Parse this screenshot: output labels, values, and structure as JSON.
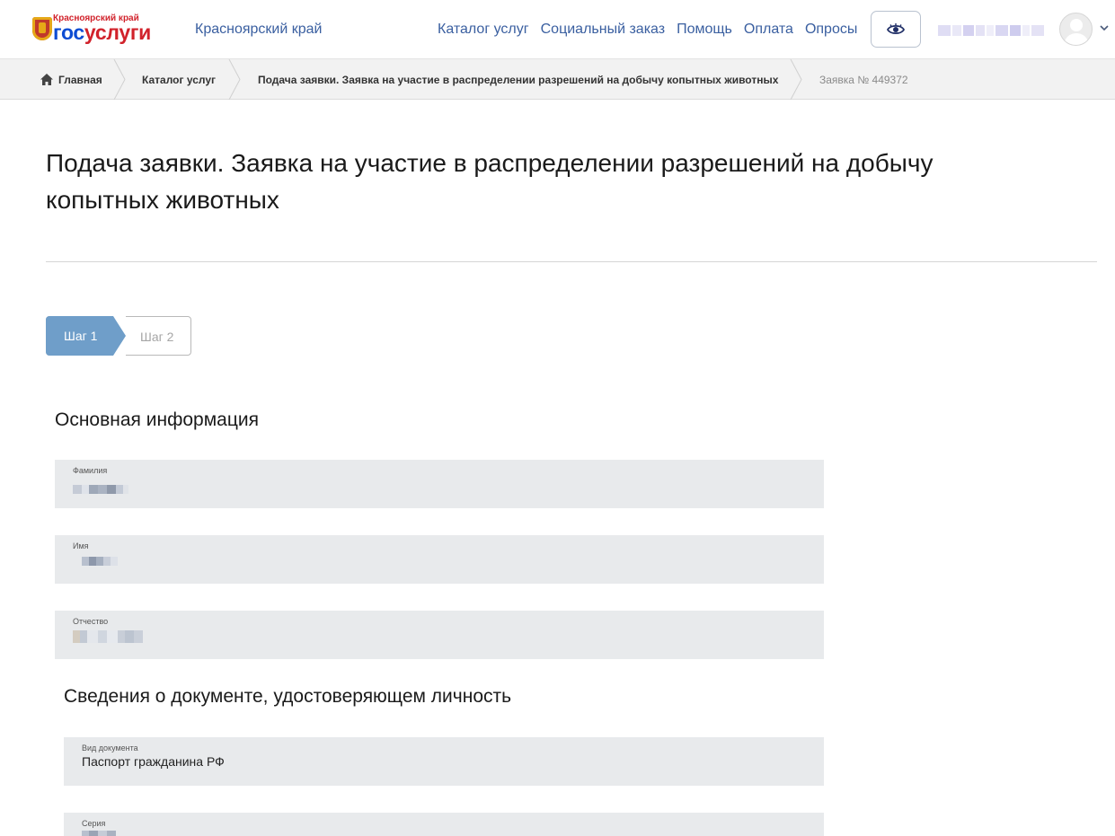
{
  "header": {
    "logo_region": "Красноярский край",
    "logo_part1": "гос",
    "logo_part2": "услуги",
    "region_label": "Красноярский край",
    "nav": [
      "Каталог услуг",
      "Социальный заказ",
      "Помощь",
      "Оплата",
      "Опросы"
    ],
    "accessibility_icon": "eye-icon",
    "user_icon": "avatar-icon",
    "menu_icon": "chevron-down-icon"
  },
  "breadcrumb": {
    "home_icon": "home-icon",
    "items": [
      "Главная",
      "Каталог услуг",
      "Подача заявки. Заявка на участие в распределении разрешений на добычу копытных животных",
      "Заявка № 449372"
    ]
  },
  "page": {
    "title": "Подача заявки. Заявка на участие в распределении разрешений на добычу копытных животных"
  },
  "steps": {
    "step1": "Шаг 1",
    "step2": "Шаг 2"
  },
  "sections": {
    "basic": {
      "title": "Основная информация",
      "fields": [
        {
          "label": "Фамилия"
        },
        {
          "label": "Имя"
        },
        {
          "label": "Отчество"
        }
      ]
    },
    "document": {
      "title": "Сведения о документе, удостоверяющем личность",
      "fields": [
        {
          "label": "Вид документа",
          "value": "Паспорт гражданина РФ"
        },
        {
          "label": "Серия"
        }
      ]
    }
  },
  "colors": {
    "link": "#3a5fa0",
    "active_step": "#6f9ec9",
    "field_bg": "#e8eaec",
    "brand_blue": "#0d4cd3",
    "brand_red": "#d1222b"
  }
}
